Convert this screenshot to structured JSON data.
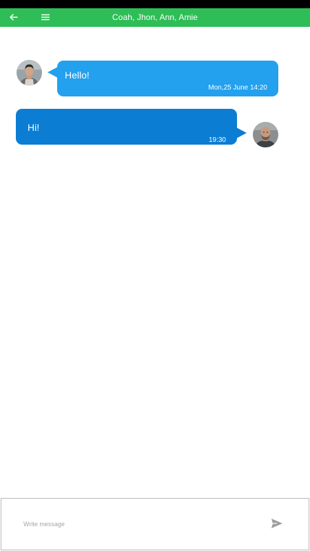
{
  "header": {
    "title": "Coah, Jhon, Ann, Amie",
    "back_icon": "arrow-left-icon",
    "menu_icon": "hamburger-menu-icon"
  },
  "messages": [
    {
      "text": "Hello!",
      "time": "Mon,25 June 14:20",
      "side": "left",
      "bubble_color": "#23a0ee",
      "avatar": "avatar-young-man"
    },
    {
      "text": "Hi!",
      "time": "19:30",
      "side": "right",
      "bubble_color": "#0b7ed3",
      "avatar": "avatar-bald-man"
    }
  ],
  "composer": {
    "placeholder": "Write message",
    "value": "",
    "send_icon": "send-icon"
  },
  "colors": {
    "status_bar": "#000000",
    "app_bar": "#2ebd57",
    "background": "#ffffff"
  }
}
